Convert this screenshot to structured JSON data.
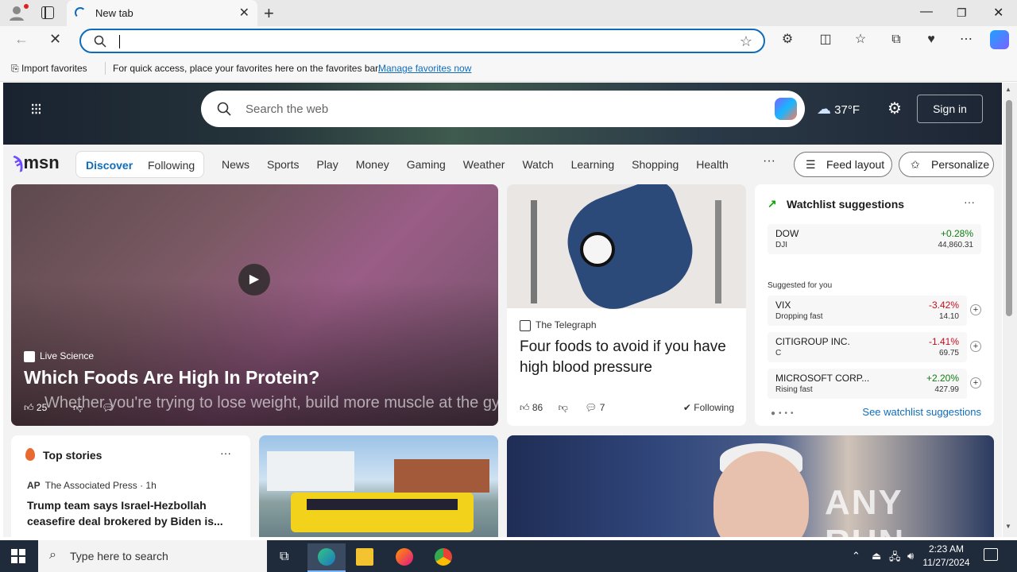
{
  "browser": {
    "tab_title": "New tab",
    "favorites_bar": {
      "import_label": "Import favorites",
      "hint": "For quick access, place your favorites here on the favorites bar.",
      "manage_link": "Manage favorites now"
    }
  },
  "msn": {
    "search_placeholder": "Search the web",
    "weather_temp": "37°F",
    "signin_label": "Sign in",
    "logo_text": "msn",
    "tabs": {
      "discover": "Discover",
      "following": "Following"
    },
    "nav": [
      "News",
      "Sports",
      "Play",
      "Money",
      "Gaming",
      "Weather",
      "Watch",
      "Learning",
      "Shopping",
      "Health"
    ],
    "more": "···",
    "feed_layout": "Feed layout",
    "personalize": "Personalize",
    "hero_card": {
      "source": "Live Science",
      "title": "Which Foods Are High In Protein?",
      "subtitle": "Whether you're trying to lose weight, build more muscle at the gym, or simply feel your best",
      "likes": "25"
    },
    "telegraph_card": {
      "source": "The Telegraph",
      "title": "Four foods to avoid if you have high blood pressure",
      "likes": "86",
      "comments": "7",
      "following": "Following"
    },
    "watchlist": {
      "title": "Watchlist suggestions",
      "more": "···",
      "main": {
        "name": "DOW",
        "symbol": "DJI",
        "change": "+0.28%",
        "value": "44,860.31"
      },
      "suggested_label": "Suggested for you",
      "items": [
        {
          "name": "VIX",
          "sub": "Dropping fast",
          "change": "-3.42%",
          "value": "14.10"
        },
        {
          "name": "CITIGROUP INC.",
          "sub": "C",
          "change": "-1.41%",
          "value": "69.75"
        },
        {
          "name": "MICROSOFT CORP...",
          "sub": "Rising fast",
          "change": "+2.20%",
          "value": "427.99"
        }
      ],
      "see_link": "See watchlist suggestions"
    },
    "top_stories": {
      "title": "Top stories",
      "more": "···",
      "source": "The Associated Press · 1h",
      "headline": "Trump team says Israel-Hezbollah ceasefire deal brokered by Biden is..."
    },
    "watermark": "ANY RUN"
  },
  "taskbar": {
    "search_placeholder": "Type here to search",
    "time": "2:23 AM",
    "date": "11/27/2024"
  }
}
